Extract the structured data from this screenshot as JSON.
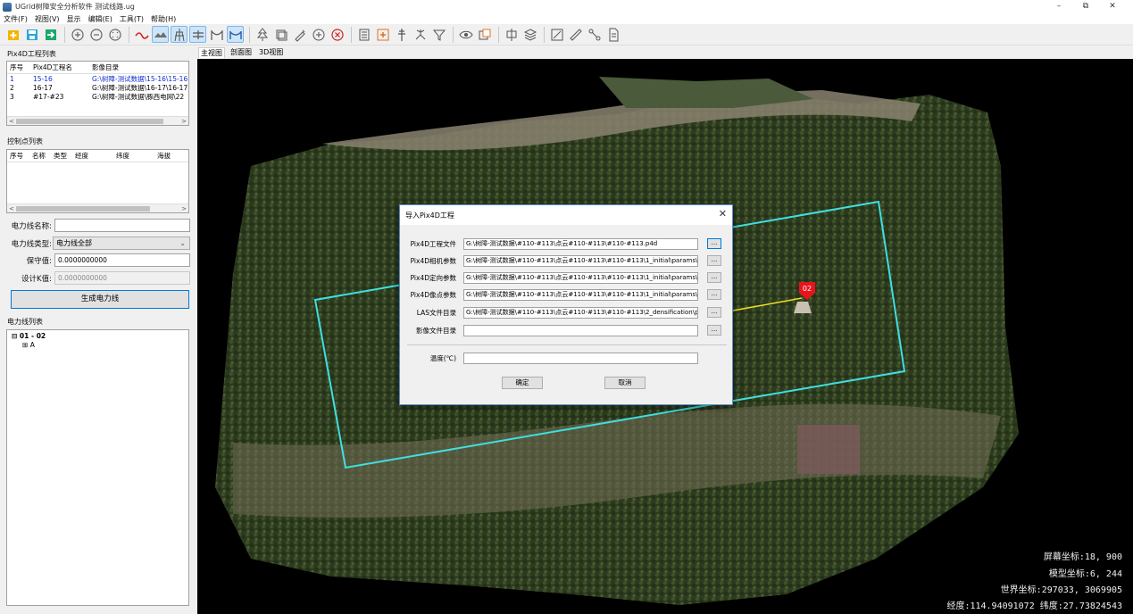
{
  "window": {
    "title": "UGrid树障安全分析软件 测试线路.ug",
    "controls": [
      "–",
      "⧉",
      "✕"
    ]
  },
  "menu": [
    "文件(F)",
    "视图(V)",
    "显示",
    "编辑(E)",
    "工具(T)",
    "帮助(H)"
  ],
  "pix4d_list": {
    "title": "Pix4D工程列表",
    "columns": [
      "序号",
      "Pix4D工程名",
      "影像目录"
    ],
    "rows": [
      [
        "1",
        "15-16",
        "G:\\树障-测试数据\\15-16\\15-16"
      ],
      [
        "2",
        "16-17",
        "G:\\树障-测试数据\\16-17\\16-17"
      ],
      [
        "3",
        "#17-#23",
        "G:\\树障-测试数据\\豚西电网\\22"
      ]
    ]
  },
  "control_points": {
    "title": "控制点列表",
    "columns": [
      "序号",
      "名称",
      "类型",
      "经度",
      "纬度",
      "海拔"
    ]
  },
  "form": {
    "line_name_label": "电力线名称:",
    "line_name_value": "",
    "line_type_label": "电力线类型:",
    "line_type_value": "电力线全部",
    "keep_label": "保守值:",
    "keep_value": "0.0000000000",
    "design_label": "设计K值:",
    "design_value": "0.0000000000",
    "generate_button": "生成电力线"
  },
  "line_list": {
    "title": "电力线列表",
    "root": "01 - 02",
    "child": "A"
  },
  "view_tabs": [
    "主视图",
    "剖面图",
    "3D视图"
  ],
  "viewport": {
    "marker_label": "02",
    "screen_coord": "屏幕坐标:18, 900",
    "model_coord": "模型坐标:6, 244",
    "world_coord": "世界坐标:297033, 3069905",
    "lonlat": "经度:114.94091072  纬度:27.73824543",
    "colors": {
      "boundary": "#3fe0e0",
      "powerline": "#f2e020",
      "marker": "#e8141c"
    }
  },
  "dialog": {
    "title": "导入Pix4D工程",
    "close": "✕",
    "fields": [
      {
        "label": "Pix4D工程文件",
        "value": "G:\\树障-测试数据\\#110-#113\\点云#110-#113\\#110-#113.p4d"
      },
      {
        "label": "Pix4D相机参数",
        "value": "G:\\树障-测试数据\\#110-#113\\点云#110-#113\\#110-#113\\1_initial\\params\\#11"
      },
      {
        "label": "Pix4D定向参数",
        "value": "G:\\树障-测试数据\\#110-#113\\点云#110-#113\\#110-#113\\1_initial\\params\\#11"
      },
      {
        "label": "Pix4D像点参数",
        "value": "G:\\树障-测试数据\\#110-#113\\点云#110-#113\\#110-#113\\1_initial\\params\\#11"
      },
      {
        "label": "LAS文件目录",
        "value": "G:\\树障-测试数据\\#110-#113\\点云#110-#113\\#110-#113\\2_densification\\poin"
      },
      {
        "label": "影像文件目录",
        "value": ""
      }
    ],
    "browse": "...",
    "temp_label": "温度(℃)",
    "temp_value": "",
    "ok": "确定",
    "cancel": "取消"
  }
}
